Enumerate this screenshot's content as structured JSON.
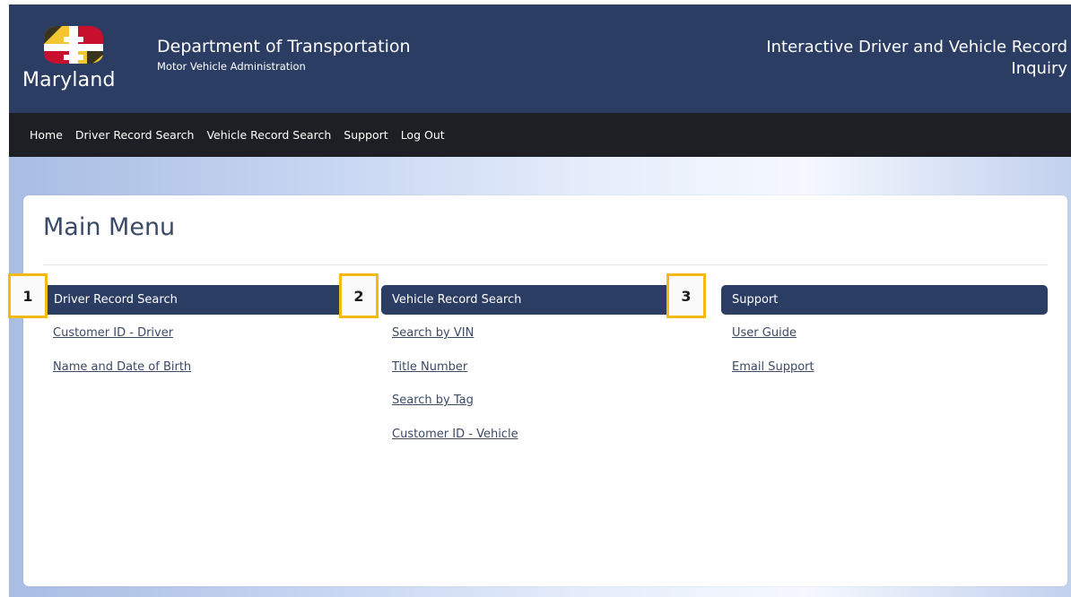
{
  "header": {
    "logo_text": "Maryland",
    "department": "Department of Transportation",
    "subtitle": "Motor Vehicle Administration",
    "app_title": "Interactive Driver and Vehicle Record Inquiry",
    "colors": {
      "header_bg": "#2b3d63",
      "nav_bg": "#1e1f24",
      "callout_border": "#f5b915"
    }
  },
  "nav": {
    "items": [
      {
        "label": "Home"
      },
      {
        "label": "Driver Record Search"
      },
      {
        "label": "Vehicle Record Search"
      },
      {
        "label": "Support"
      },
      {
        "label": "Log Out"
      }
    ]
  },
  "main": {
    "title": "Main Menu",
    "sections": [
      {
        "callout": "1",
        "heading": "Driver Record Search",
        "links": [
          "Customer ID - Driver",
          "Name and Date of Birth"
        ]
      },
      {
        "callout": "2",
        "heading": "Vehicle Record Search",
        "links": [
          "Search by VIN",
          "Title Number",
          "Search by Tag",
          "Customer ID - Vehicle"
        ]
      },
      {
        "callout": "3",
        "heading": "Support",
        "links": [
          "User Guide",
          "Email Support"
        ]
      }
    ]
  }
}
